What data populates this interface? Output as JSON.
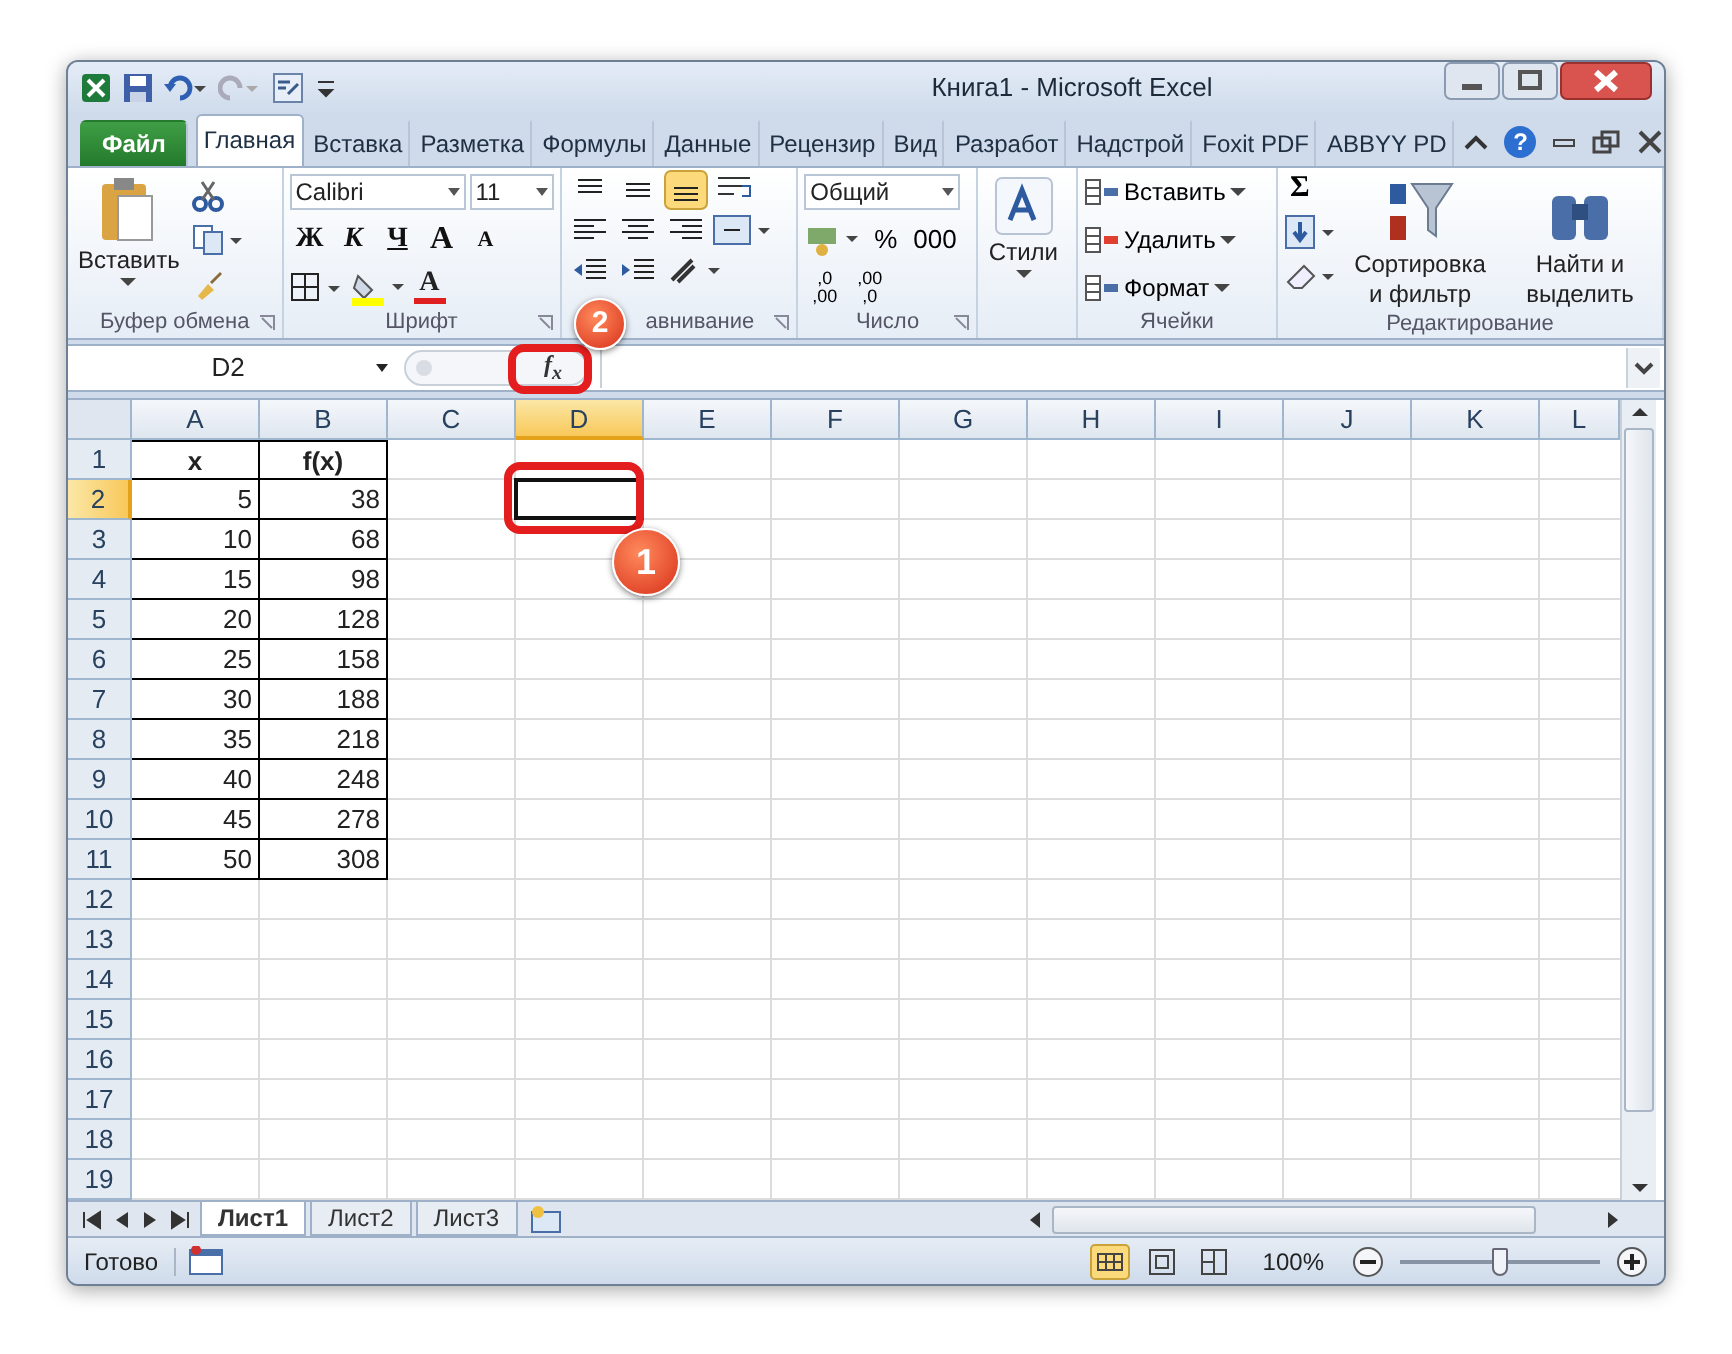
{
  "window": {
    "title": "Книга1 - Microsoft Excel"
  },
  "tabs": [
    {
      "label": "Файл",
      "kind": "file",
      "selected": false
    },
    {
      "label": "Главная",
      "kind": "tab",
      "selected": true
    },
    {
      "label": "Вставка",
      "kind": "tab",
      "selected": false
    },
    {
      "label": "Разметка",
      "kind": "tab",
      "selected": false
    },
    {
      "label": "Формулы",
      "kind": "tab",
      "selected": false
    },
    {
      "label": "Данные",
      "kind": "tab",
      "selected": false
    },
    {
      "label": "Рецензир",
      "kind": "tab",
      "selected": false
    },
    {
      "label": "Вид",
      "kind": "tab",
      "selected": false
    },
    {
      "label": "Разработ",
      "kind": "tab",
      "selected": false
    },
    {
      "label": "Надстрой",
      "kind": "tab",
      "selected": false
    },
    {
      "label": "Foxit PDF",
      "kind": "tab",
      "selected": false
    },
    {
      "label": "ABBYY PD",
      "kind": "tab",
      "selected": false
    }
  ],
  "help": "?",
  "ribbon": {
    "groups": [
      {
        "kind": "clipboard",
        "label": "Буфер обмена",
        "launcher": true,
        "paste": "Вставить"
      },
      {
        "kind": "font",
        "label": "Шрифт",
        "launcher": true,
        "font": "Calibri",
        "size": "11",
        "styles": [
          "Ж",
          "К",
          "Ч"
        ],
        "grow": "A",
        "shrink": "A",
        "color_letter": "A"
      },
      {
        "kind": "align",
        "label": "авнивание",
        "launcher": true,
        "vertical": [
          {
            "selected": false
          },
          {
            "selected": false
          },
          {
            "selected": true
          }
        ]
      },
      {
        "kind": "number",
        "label": "Число",
        "launcher": true,
        "format": "Общий",
        "percent": "%",
        "thousands": "000",
        "decimals": [
          [
            ",0",
            ",00"
          ],
          [
            ",00",
            ",0"
          ]
        ]
      },
      {
        "kind": "styles",
        "launcher": false,
        "button": "Стили"
      },
      {
        "kind": "cells",
        "label": "Ячейки",
        "launcher": false,
        "items": [
          "Вставить",
          "Удалить",
          "Формат"
        ]
      },
      {
        "kind": "editing",
        "label": "Редактирование",
        "launcher": false,
        "sigma": "Σ",
        "sort": [
          "Сортировка",
          "и фильтр"
        ],
        "find": [
          "Найти и",
          "выделить"
        ]
      }
    ]
  },
  "formula_bar": {
    "name_box": "D2",
    "fx": "f$_{x}$"
  },
  "grid": {
    "columns": [
      {
        "label": "A",
        "selected": false
      },
      {
        "label": "B",
        "selected": false
      },
      {
        "label": "C",
        "selected": false
      },
      {
        "label": "D",
        "selected": true
      },
      {
        "label": "E",
        "selected": false
      },
      {
        "label": "F",
        "selected": false
      },
      {
        "label": "G",
        "selected": false
      },
      {
        "label": "H",
        "selected": false
      },
      {
        "label": "I",
        "selected": false
      },
      {
        "label": "J",
        "selected": false
      },
      {
        "label": "K",
        "selected": false
      },
      {
        "label": "L",
        "selected": false
      }
    ],
    "rows": [
      {
        "number": "1",
        "kind": "heading",
        "selected": false,
        "cells": [
          "x",
          "f(x)"
        ]
      },
      {
        "number": "2",
        "kind": "data",
        "selected": true,
        "cells": [
          "5",
          "38"
        ]
      },
      {
        "number": "3",
        "kind": "data",
        "selected": false,
        "cells": [
          "10",
          "68"
        ]
      },
      {
        "number": "4",
        "kind": "data",
        "selected": false,
        "cells": [
          "15",
          "98"
        ]
      },
      {
        "number": "5",
        "kind": "data",
        "selected": false,
        "cells": [
          "20",
          "128"
        ]
      },
      {
        "number": "6",
        "kind": "data",
        "selected": false,
        "cells": [
          "25",
          "158"
        ]
      },
      {
        "number": "7",
        "kind": "data",
        "selected": false,
        "cells": [
          "30",
          "188"
        ]
      },
      {
        "number": "8",
        "kind": "data",
        "selected": false,
        "cells": [
          "35",
          "218"
        ]
      },
      {
        "number": "9",
        "kind": "data",
        "selected": false,
        "cells": [
          "40",
          "248"
        ]
      },
      {
        "number": "10",
        "kind": "data",
        "selected": false,
        "cells": [
          "45",
          "278"
        ]
      },
      {
        "number": "11",
        "kind": "data",
        "selected": false,
        "cells": [
          "50",
          "308"
        ]
      },
      {
        "number": "12",
        "kind": "data",
        "selected": false,
        "cells": []
      },
      {
        "number": "13",
        "kind": "data",
        "selected": false,
        "cells": []
      },
      {
        "number": "14",
        "kind": "data",
        "selected": false,
        "cells": []
      },
      {
        "number": "15",
        "kind": "data",
        "selected": false,
        "cells": []
      },
      {
        "number": "16",
        "kind": "data",
        "selected": false,
        "cells": []
      },
      {
        "number": "17",
        "kind": "data",
        "selected": false,
        "cells": []
      },
      {
        "number": "18",
        "kind": "data",
        "selected": false,
        "cells": []
      },
      {
        "number": "19",
        "kind": "data",
        "selected": false,
        "cells": []
      }
    ]
  },
  "sheets": [
    {
      "label": "Лист1",
      "selected": true
    },
    {
      "label": "Лист2",
      "selected": false
    },
    {
      "label": "Лист3",
      "selected": false
    }
  ],
  "status_bar": {
    "text": "Готово",
    "zoom": "100%",
    "level": 0.5
  },
  "callouts": [
    {
      "number": "1",
      "kind": "cell"
    },
    {
      "number": "2",
      "kind": "fx"
    }
  ]
}
